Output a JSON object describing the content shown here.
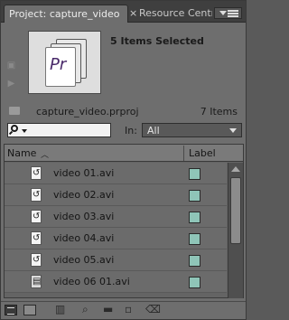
{
  "tabs": {
    "active": "Project: capture_video",
    "close_glyph": "×",
    "inactive": "Resource Centr"
  },
  "preview": {
    "thumbnail_text": "Pr",
    "items_selected": "5 Items Selected",
    "project_file": "capture_video.prproj",
    "items_count": "7 Items"
  },
  "search": {
    "in_label": "In:",
    "in_value": "All"
  },
  "list": {
    "header_name": "Name",
    "header_label": "Label",
    "rows": [
      {
        "name": "video 01.avi",
        "label_color": "#8fc5b8",
        "icon": "refresh-clip-icon"
      },
      {
        "name": "video 02.avi",
        "label_color": "#8fc5b8",
        "icon": "refresh-clip-icon"
      },
      {
        "name": "video 03.avi",
        "label_color": "#8fc5b8",
        "icon": "refresh-clip-icon"
      },
      {
        "name": "video 04.avi",
        "label_color": "#8fc5b8",
        "icon": "refresh-clip-icon"
      },
      {
        "name": "video 05.avi",
        "label_color": "#8fc5b8",
        "icon": "refresh-clip-icon"
      },
      {
        "name": "video 06 01.avi",
        "label_color": "#8fc5b8",
        "icon": "film-clip-icon"
      }
    ]
  },
  "toolbar": {
    "icons": [
      "list-view-icon",
      "icon-view-icon",
      "automate-to-sequence-icon",
      "find-icon",
      "new-bin-icon",
      "new-item-icon",
      "clear-icon"
    ]
  },
  "colors": {
    "label_swatch": "#8fc5b8",
    "panel_bg": "#6e6e6e"
  }
}
